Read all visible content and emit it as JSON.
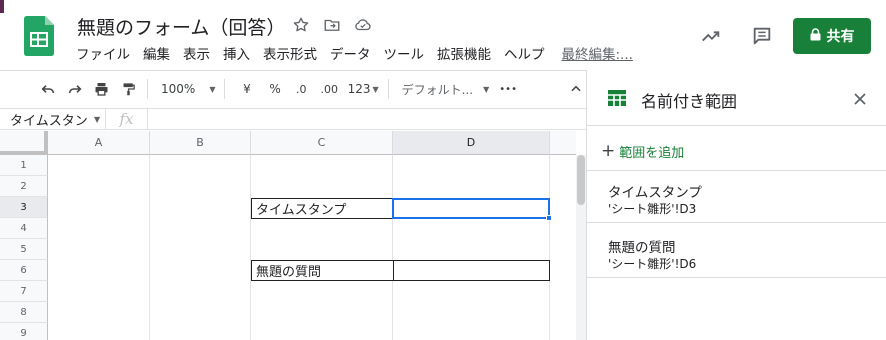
{
  "doc": {
    "title": "無題のフォーム（回答）"
  },
  "menu": {
    "items": [
      "ファイル",
      "編集",
      "表示",
      "挿入",
      "表示形式",
      "データ",
      "ツール",
      "拡張機能",
      "ヘルプ"
    ],
    "last_edit": "最終編集:..."
  },
  "header": {
    "share_label": "共有"
  },
  "toolbar": {
    "zoom": "100%",
    "currency": "¥",
    "percent": "%",
    "decrease_decimal": ".0",
    "increase_decimal": ".00",
    "number_format": "123",
    "font": "デフォルト...",
    "more": "•••"
  },
  "formula_bar": {
    "name_box": "タイムスタンプ",
    "fx": "fx",
    "value": ""
  },
  "grid": {
    "columns": [
      "A",
      "B",
      "C",
      "D"
    ],
    "rows": [
      "1",
      "2",
      "3",
      "4",
      "5",
      "6",
      "7",
      "8",
      "9"
    ],
    "cells": {
      "C3": "タイムスタンプ",
      "C6": "無題の質問"
    }
  },
  "panel": {
    "title": "名前付き範囲",
    "add_label": "範囲を追加",
    "ranges": [
      {
        "name": "タイムスタンプ",
        "ref": "'シート雛形'!D3"
      },
      {
        "name": "無題の質問",
        "ref": "'シート雛形'!D6"
      }
    ]
  },
  "colors": {
    "accent": "#188038",
    "selection": "#1a73e8"
  },
  "icons": [
    "sheets-logo-icon",
    "star-icon",
    "move-folder-icon",
    "cloud-status-icon",
    "trending-icon",
    "comment-icon",
    "lock-icon",
    "undo-icon",
    "redo-icon",
    "print-icon",
    "paint-format-icon",
    "collapse-icon",
    "table-icon",
    "close-icon"
  ]
}
